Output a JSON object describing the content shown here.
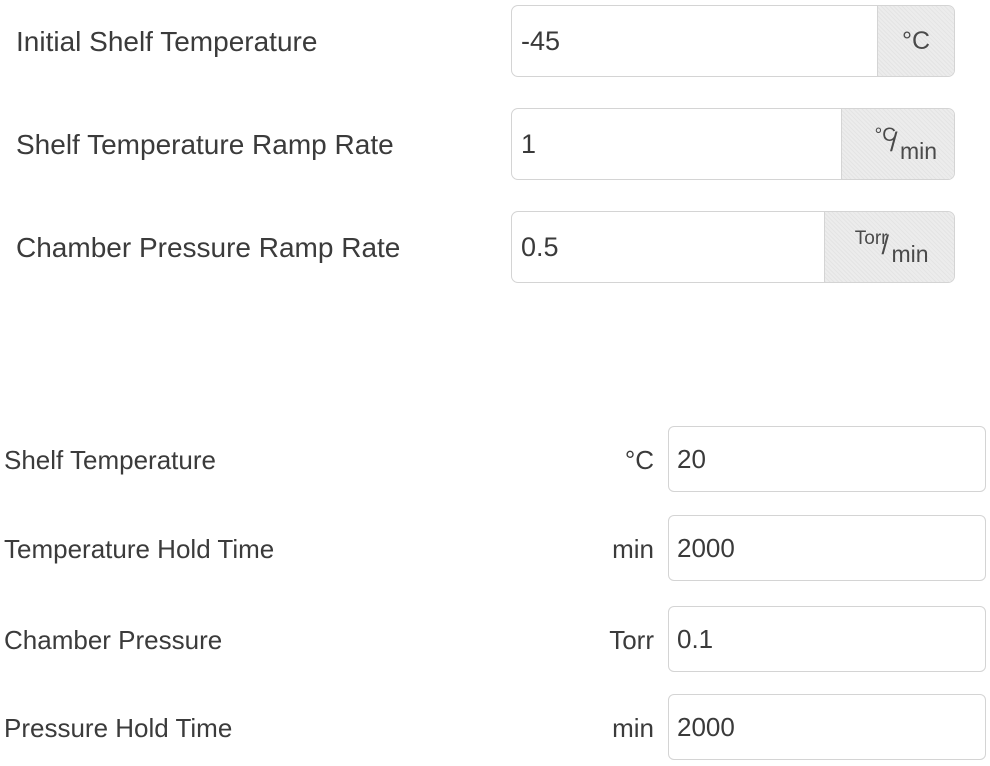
{
  "ramp_form": {
    "initial_shelf_temperature": {
      "label": "Initial Shelf Temperature",
      "value": "-45",
      "unit": "°C"
    },
    "shelf_temperature_ramp_rate": {
      "label": "Shelf Temperature Ramp Rate",
      "value": "1",
      "unit_numerator": "°C",
      "unit_slash": "/",
      "unit_denominator": "min"
    },
    "chamber_pressure_ramp_rate": {
      "label": "Chamber Pressure Ramp Rate",
      "value": "0.5",
      "unit_numerator": "Torr",
      "unit_slash": "/",
      "unit_denominator": "min"
    }
  },
  "step_form": {
    "shelf_temperature": {
      "label": "Shelf Temperature",
      "unit": "°C",
      "value": "20"
    },
    "temperature_hold_time": {
      "label": "Temperature Hold Time",
      "unit": "min",
      "value": "2000"
    },
    "chamber_pressure": {
      "label": "Chamber Pressure",
      "unit": "Torr",
      "value": "0.1"
    },
    "pressure_hold_time": {
      "label": "Pressure Hold Time",
      "unit": "min",
      "value": "2000"
    }
  }
}
